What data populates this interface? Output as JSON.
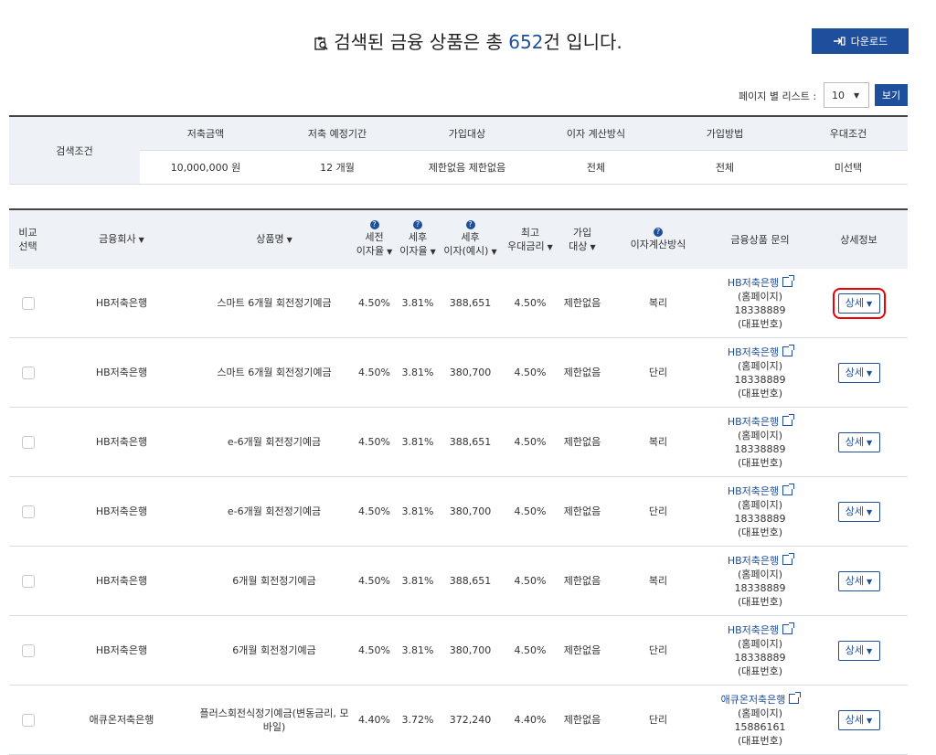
{
  "header": {
    "title_prefix": "검색된 금융 상품은 총 ",
    "count": "652",
    "title_suffix": "건 입니다.",
    "download_label": "다운로드"
  },
  "paging": {
    "label": "페이지 별 리스트 :",
    "page_size": "10",
    "view_label": "보기"
  },
  "conditions": {
    "section_label": "검색조건",
    "headers": [
      "저축금액",
      "저축 예정기간",
      "가입대상",
      "이자 계산방식",
      "가입방법",
      "우대조건"
    ],
    "values": [
      "10,000,000 원",
      "12 개월",
      "제한없음 제한없음",
      "전체",
      "전체",
      "미선택"
    ]
  },
  "table": {
    "col_compare": [
      "비교",
      "선택"
    ],
    "col_company": "금융회사",
    "col_product": "상품명",
    "col_pretax": [
      "세전",
      "이자율"
    ],
    "col_posttax": [
      "세후",
      "이자율"
    ],
    "col_interest": [
      "세후",
      "이자(예시)"
    ],
    "col_max": [
      "최고",
      "우대금리"
    ],
    "col_target": [
      "가입",
      "대상"
    ],
    "col_method": "이자계산방식",
    "col_inquiry": "금융상품 문의",
    "col_detail": "상세정보",
    "detail_label": "상세",
    "rows": [
      {
        "company": "HB저축은행",
        "product": "스마트 6개월 회전정기예금",
        "pretax": "4.50%",
        "posttax": "3.81%",
        "interest": "388,651",
        "max": "4.50%",
        "target": "제한없음",
        "method": "복리",
        "link": "HB저축은행",
        "home": "(홈페이지)",
        "phone": "18338889",
        "rep": "(대표번호)"
      },
      {
        "company": "HB저축은행",
        "product": "스마트 6개월 회전정기예금",
        "pretax": "4.50%",
        "posttax": "3.81%",
        "interest": "380,700",
        "max": "4.50%",
        "target": "제한없음",
        "method": "단리",
        "link": "HB저축은행",
        "home": "(홈페이지)",
        "phone": "18338889",
        "rep": "(대표번호)"
      },
      {
        "company": "HB저축은행",
        "product": "e-6개월 회전정기예금",
        "pretax": "4.50%",
        "posttax": "3.81%",
        "interest": "388,651",
        "max": "4.50%",
        "target": "제한없음",
        "method": "복리",
        "link": "HB저축은행",
        "home": "(홈페이지)",
        "phone": "18338889",
        "rep": "(대표번호)"
      },
      {
        "company": "HB저축은행",
        "product": "e-6개월 회전정기예금",
        "pretax": "4.50%",
        "posttax": "3.81%",
        "interest": "380,700",
        "max": "4.50%",
        "target": "제한없음",
        "method": "단리",
        "link": "HB저축은행",
        "home": "(홈페이지)",
        "phone": "18338889",
        "rep": "(대표번호)"
      },
      {
        "company": "HB저축은행",
        "product": "6개월 회전정기예금",
        "pretax": "4.50%",
        "posttax": "3.81%",
        "interest": "388,651",
        "max": "4.50%",
        "target": "제한없음",
        "method": "복리",
        "link": "HB저축은행",
        "home": "(홈페이지)",
        "phone": "18338889",
        "rep": "(대표번호)"
      },
      {
        "company": "HB저축은행",
        "product": "6개월 회전정기예금",
        "pretax": "4.50%",
        "posttax": "3.81%",
        "interest": "380,700",
        "max": "4.50%",
        "target": "제한없음",
        "method": "단리",
        "link": "HB저축은행",
        "home": "(홈페이지)",
        "phone": "18338889",
        "rep": "(대표번호)"
      },
      {
        "company": "애큐온저축은행",
        "product": "플러스회전식정기예금(변동금리, 모바일)",
        "pretax": "4.40%",
        "posttax": "3.72%",
        "interest": "372,240",
        "max": "4.40%",
        "target": "제한없음",
        "method": "단리",
        "link": "애큐온저축은행",
        "home": "(홈페이지)",
        "phone": "15886161",
        "rep": "(대표번호)"
      }
    ]
  },
  "colors": {
    "accent": "#1e4f9c",
    "header_bg": "#eef2f7",
    "highlight": "#e00000"
  }
}
